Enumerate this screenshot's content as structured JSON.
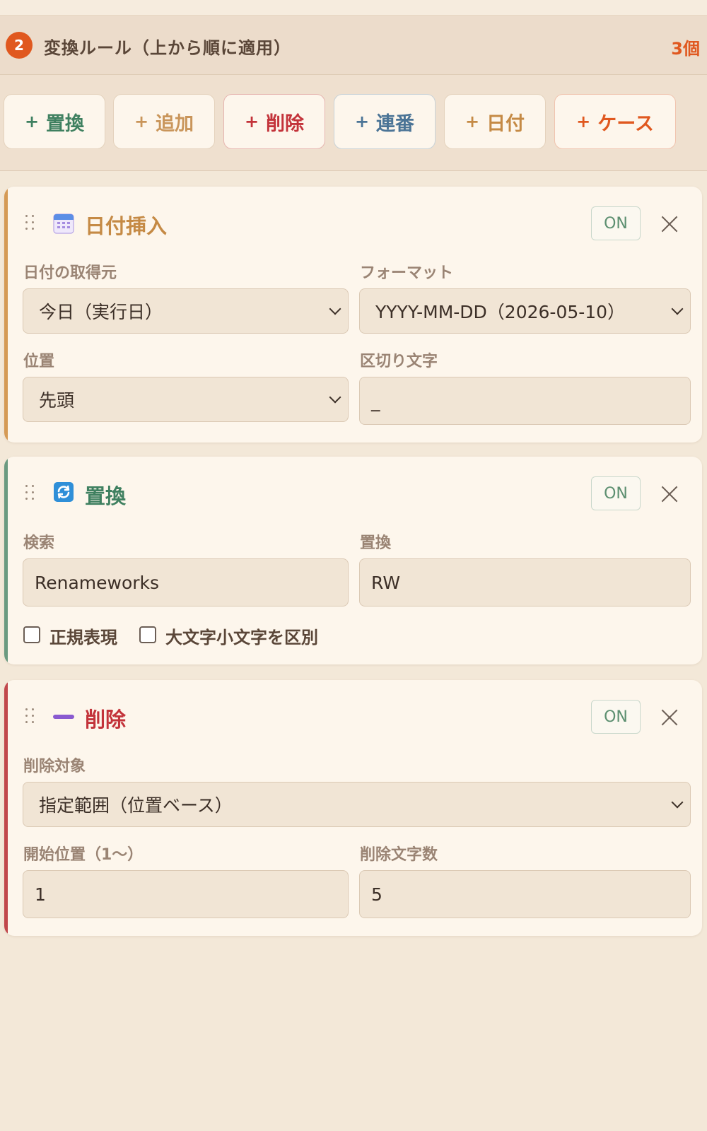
{
  "section": {
    "step": "2",
    "title": "変換ルール（上から順に適用）",
    "count": "3個"
  },
  "toolbar": {
    "plus": "+",
    "replace": "置換",
    "append": "追加",
    "delete": "削除",
    "serial": "連番",
    "date": "日付",
    "case": "ケース"
  },
  "rules": {
    "date_insert": {
      "icon": "calendar-icon",
      "title": "日付挿入",
      "toggle": "ON",
      "source_label": "日付の取得元",
      "source_value": "今日（実行日）",
      "format_label": "フォーマット",
      "format_value": "YYYY-MM-DD（2026-05-10）",
      "position_label": "位置",
      "position_value": "先頭",
      "separator_label": "区切り文字",
      "separator_value": "_"
    },
    "replace": {
      "icon": "refresh-icon",
      "title": "置換",
      "toggle": "ON",
      "search_label": "検索",
      "search_value": "Renameworks",
      "replace_label": "置換",
      "replace_value": "RW",
      "regex_label": "正規表現",
      "case_label": "大文字小文字を区別"
    },
    "delete": {
      "icon": "minus-icon",
      "title": "削除",
      "toggle": "ON",
      "target_label": "削除対象",
      "target_value": "指定範囲（位置ベース）",
      "start_label": "開始位置（1〜）",
      "start_value": "1",
      "length_label": "削除文字数",
      "length_value": "5"
    }
  },
  "colors": {
    "accent": "#e0581f",
    "replace": "#3f8060",
    "delete": "#c3333a",
    "date": "#c58a45",
    "serial": "#4b7496"
  }
}
